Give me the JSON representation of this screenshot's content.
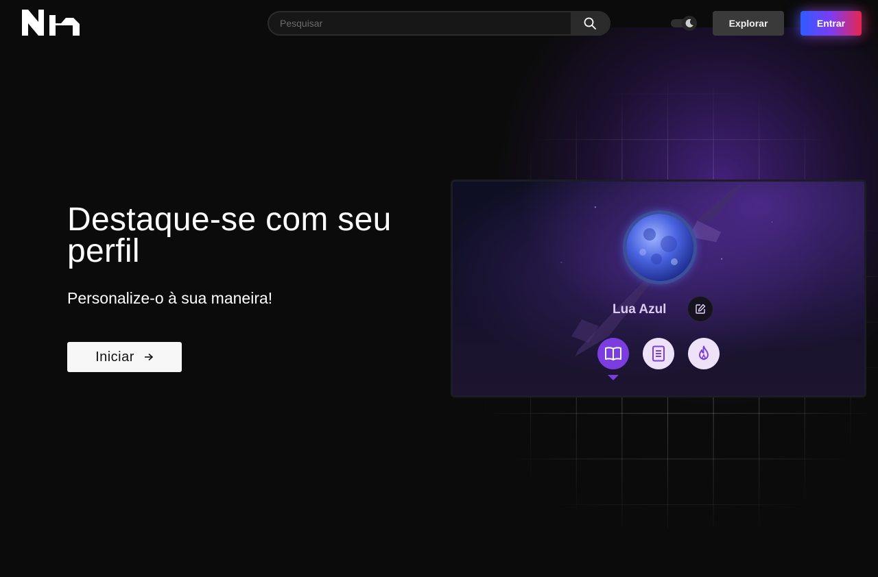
{
  "header": {
    "logo_text": "Nh",
    "search": {
      "placeholder": "Pesquisar",
      "value": ""
    },
    "theme_toggle": {
      "mode": "dark"
    },
    "explore_label": "Explorar",
    "enter_label": "Entrar"
  },
  "hero": {
    "title": "Destaque-se com seu perfil",
    "subtitle": "Personalize-o à sua maneira!",
    "cta_label": "Iniciar"
  },
  "profile_card": {
    "username": "Lua Azul",
    "badges": [
      {
        "icon": "open-book-icon",
        "active": true
      },
      {
        "icon": "document-icon",
        "active": false
      },
      {
        "icon": "flame-icon",
        "active": false
      }
    ]
  },
  "colors": {
    "background": "#0b0b0b",
    "accent_purple": "#7b3de0",
    "badge_light": "#eee2f9",
    "gradient_start": "#2e5cff",
    "gradient_end": "#e6264e"
  }
}
